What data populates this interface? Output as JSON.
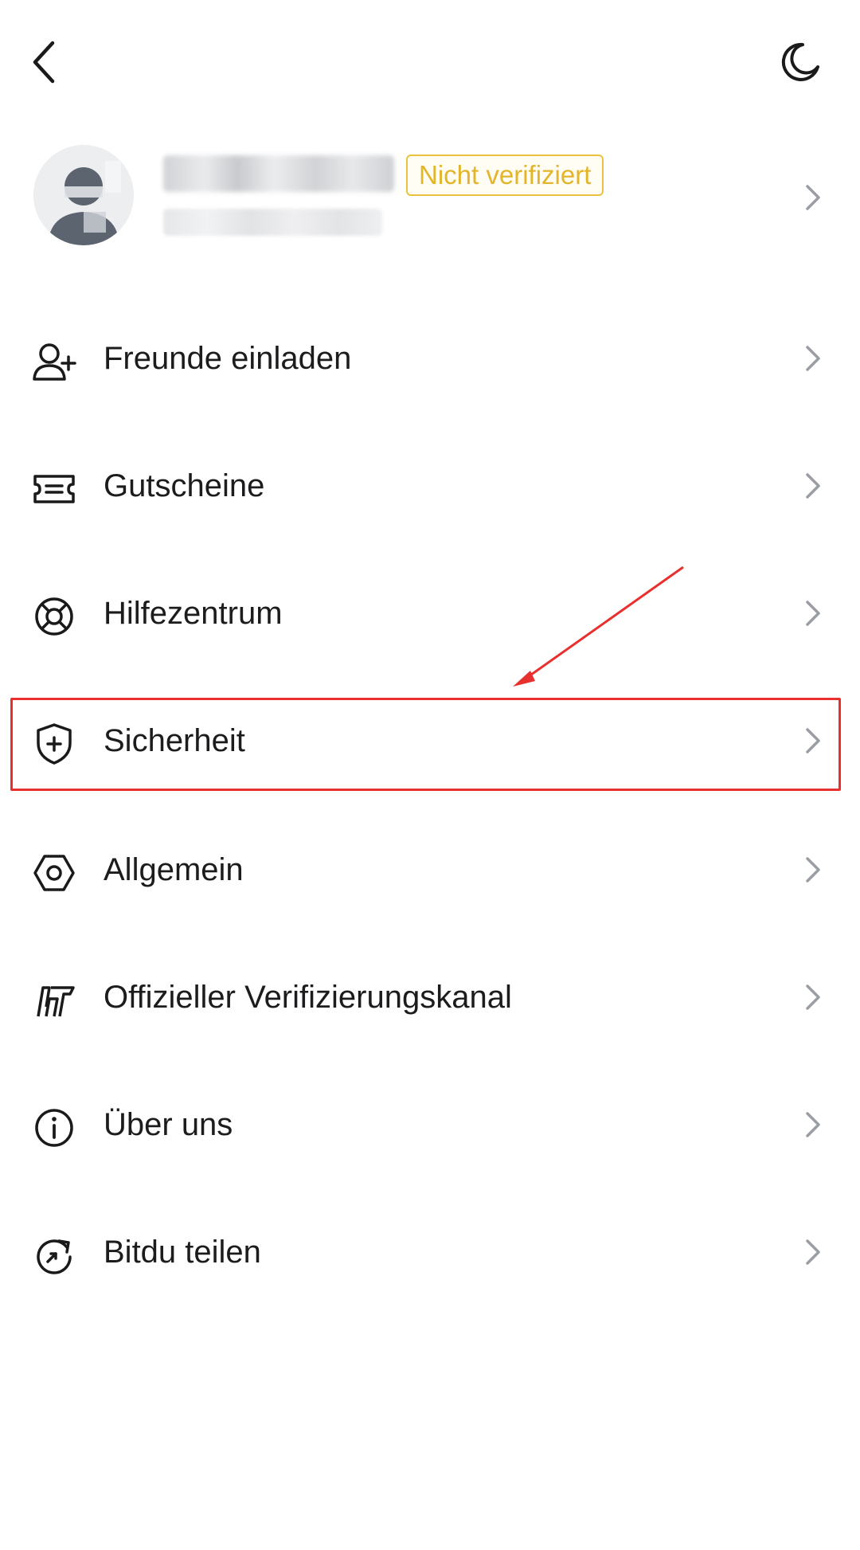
{
  "header": {
    "back_icon": "chevron-left-icon",
    "theme_icon": "moon-icon"
  },
  "profile": {
    "badge": "Nicht verifiziert",
    "badge_color": "#e3b52a"
  },
  "menu": [
    {
      "id": "invite",
      "label": "Freunde einladen",
      "icon": "user-plus-icon"
    },
    {
      "id": "coupons",
      "label": "Gutscheine",
      "icon": "ticket-icon"
    },
    {
      "id": "help",
      "label": "Hilfezentrum",
      "icon": "lifebuoy-icon"
    },
    {
      "id": "security",
      "label": "Sicherheit",
      "icon": "shield-plus-icon",
      "highlighted": true
    },
    {
      "id": "general",
      "label": "Allgemein",
      "icon": "hexagon-gear-icon"
    },
    {
      "id": "verification",
      "label": "Offizieller Verifizierungskanal",
      "icon": "bitdu-logo-icon"
    },
    {
      "id": "about",
      "label": "Über uns",
      "icon": "info-icon"
    },
    {
      "id": "share",
      "label": "Bitdu teilen",
      "icon": "share-refresh-icon"
    }
  ],
  "annotation": {
    "highlight_color": "#e8312e"
  }
}
